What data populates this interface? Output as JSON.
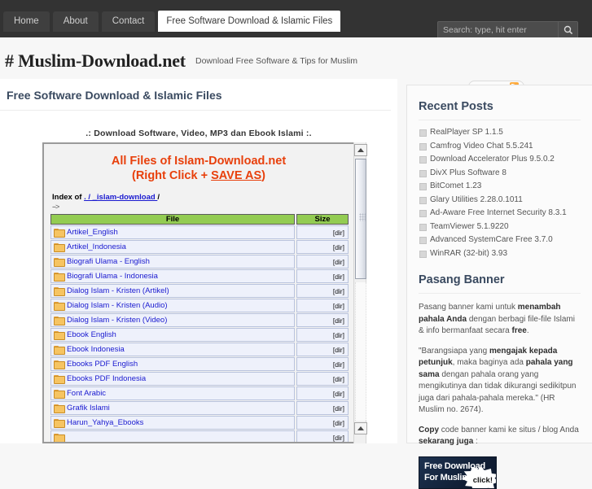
{
  "nav": {
    "tabs": [
      {
        "label": "Home",
        "active": false
      },
      {
        "label": "About",
        "active": false
      },
      {
        "label": "Contact",
        "active": false
      },
      {
        "label": "Free Software Download & Islamic Files",
        "active": true
      }
    ]
  },
  "search": {
    "value": "",
    "placeholder": "Search: type, hit enter",
    "icon": "search-icon"
  },
  "site": {
    "title": "# Muslim-Download.net",
    "tagline": "Download Free Software & Tips for Muslim"
  },
  "main": {
    "heading": "Free Software Download & Islamic Files",
    "subtitle": ".: Download Software, Video, MP3 dan Ebook Islami :."
  },
  "frame": {
    "title_line1": "All Files of Islam-Download.net",
    "title_line2_pre": "(Right Click + ",
    "title_line2_link": "SAVE AS",
    "title_line2_post": ")",
    "index_label": "Index of ",
    "index_root": ". /",
    "index_dir": " _islam-download ",
    "index_slash": "/",
    "arrow": "-->",
    "columns": [
      "File",
      "Size"
    ],
    "rows": [
      {
        "name": "Artikel_English",
        "size": "[dir]"
      },
      {
        "name": "Artikel_Indonesia",
        "size": "[dir]"
      },
      {
        "name": "Biografi Ulama - English",
        "size": "[dir]"
      },
      {
        "name": "Biografi Ulama - Indonesia",
        "size": "[dir]"
      },
      {
        "name": "Dialog Islam - Kristen (Artikel)",
        "size": "[dir]"
      },
      {
        "name": "Dialog Islam - Kristen (Audio)",
        "size": "[dir]"
      },
      {
        "name": "Dialog Islam - Kristen (Video)",
        "size": "[dir]"
      },
      {
        "name": "Ebook English",
        "size": "[dir]"
      },
      {
        "name": "Ebook Indonesia",
        "size": "[dir]"
      },
      {
        "name": "Ebooks PDF English",
        "size": "[dir]"
      },
      {
        "name": "Ebooks PDF Indonesia",
        "size": "[dir]"
      },
      {
        "name": "Font Arabic",
        "size": "[dir]"
      },
      {
        "name": "Grafik Islami",
        "size": "[dir]"
      },
      {
        "name": "Harun_Yahya_Ebooks",
        "size": "[dir]"
      },
      {
        "name": "",
        "size": "[dir]"
      }
    ]
  },
  "sidebar": {
    "rss_label": "RSS Feed",
    "recent_heading": "Recent Posts",
    "recent_posts": [
      "RealPlayer SP 1.1.5",
      "Camfrog Video Chat 5.5.241",
      "Download Accelerator Plus 9.5.0.2",
      "DivX Plus Software 8",
      "BitComet 1.23",
      "Glary Utilities 2.28.0.1011",
      "Ad-Aware Free Internet Security 8.3.1",
      "TeamViewer 5.1.9220",
      "Advanced SystemCare Free 3.7.0",
      "WinRAR (32-bit) 3.93"
    ],
    "banner_heading": "Pasang Banner",
    "banner_p1": "Pasang banner kami untuk menambah pahala Anda dengan berbagi file-file Islami & info bermanfaat secara free.",
    "banner_p2": "\"Barangsiapa yang mengajak kepada petunjuk, maka baginya ada pahala yang sama dengan pahala orang yang mengikutinya dan tidak dikurangi sedikitpun juga dari pahala-pahala mereka.\" (HR Muslim no. 2674).",
    "banner_p3": "Copy code banner kami ke situs / blog Anda sekarang juga :",
    "banner_image": {
      "line1": "Free Download",
      "line2": "For Muslim",
      "badge": "click!"
    }
  },
  "colors": {
    "topbar": "#333333",
    "accent_red": "#e8400c",
    "header_blue": "#3a4a60",
    "table_header_green": "#93cc52",
    "link_blue": "#1a1ad0"
  }
}
